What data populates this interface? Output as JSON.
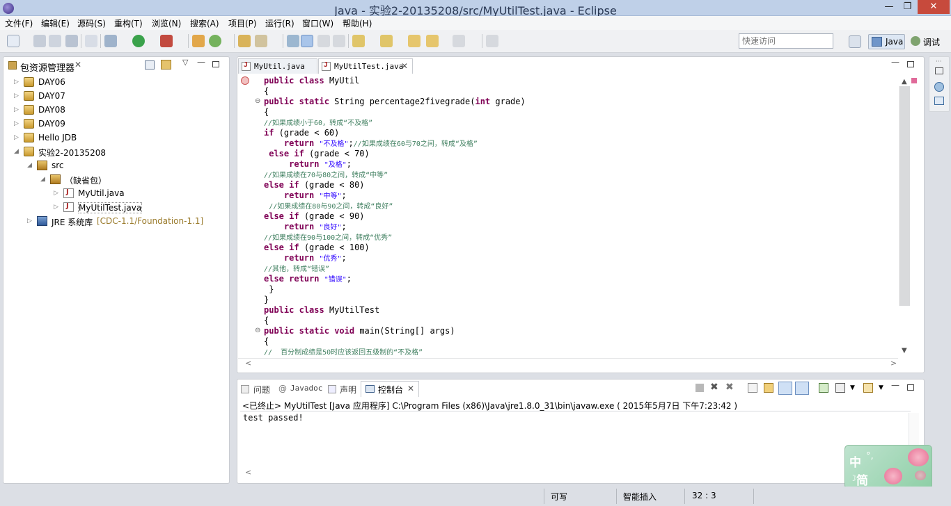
{
  "window": {
    "title": "Java  -  实验2-20135208/src/MyUtilTest.java  -  Eclipse",
    "min": "—",
    "max": "❐",
    "close": "✕"
  },
  "menu": [
    "文件(F)",
    "编辑(E)",
    "源码(S)",
    "重构(T)",
    "浏览(N)",
    "搜索(A)",
    "项目(P)",
    "运行(R)",
    "窗口(W)",
    "帮助(H)"
  ],
  "toolbar": {
    "quick_access_placeholder": "快速访问"
  },
  "perspectives": {
    "java": "Java",
    "debug": "调试"
  },
  "package_explorer": {
    "title": "包资源管理器",
    "items": [
      {
        "label": "DAY06"
      },
      {
        "label": "DAY07"
      },
      {
        "label": "DAY08"
      },
      {
        "label": "DAY09"
      },
      {
        "label": "Hello JDB"
      },
      {
        "label": "实验2-20135208"
      },
      {
        "label": "src"
      },
      {
        "label": "（缺省包）"
      },
      {
        "label": "MyUtil.java"
      },
      {
        "label": "MyUtilTest.java"
      },
      {
        "label": "JRE 系统库",
        "suffix": "[CDC-1.1/Foundation-1.1]"
      }
    ]
  },
  "editor": {
    "tabs": [
      {
        "label": "MyUtil.java"
      },
      {
        "label": "MyUtilTest.java"
      }
    ],
    "lines": [
      {
        "t": "public class MyUtil"
      },
      {
        "t": "{"
      },
      {
        "t": "public static String percentage2fivegrade(int grade)"
      },
      {
        "t": "{"
      },
      {
        "t": "//如果成绩小于60，转成“不及格”"
      },
      {
        "t": "if (grade < 60)"
      },
      {
        "t": "    return \"不及格\";//如果成绩在60与70之间，转成“及格”"
      },
      {
        "t": " else if (grade < 70)"
      },
      {
        "t": "     return \"及格\";"
      },
      {
        "t": "//如果成绩在70与80之间，转成“中等”"
      },
      {
        "t": "else if (grade < 80)"
      },
      {
        "t": "    return \"中等\";"
      },
      {
        "t": " //如果成绩在80与90之间，转成“良好”"
      },
      {
        "t": "else if (grade < 90)"
      },
      {
        "t": "    return \"良好\";"
      },
      {
        "t": "//如果成绩在90与100之间，转成“优秀”"
      },
      {
        "t": "else if (grade < 100)"
      },
      {
        "t": "    return \"优秀\";"
      },
      {
        "t": "//其他，转成“错误”"
      },
      {
        "t": "else return \"错误\";"
      },
      {
        "t": " }"
      },
      {
        "t": "}"
      },
      {
        "t": "public class MyUtilTest"
      },
      {
        "t": "{"
      },
      {
        "t": "public static void main(String[] args)"
      },
      {
        "t": "{"
      },
      {
        "t": "//  百分制成绩是50时应该返回五级制的“不及格”"
      }
    ]
  },
  "console": {
    "tabs": [
      "问题",
      "Javadoc",
      "声明",
      "控制台"
    ],
    "header": "<已终止> MyUtilTest [Java 应用程序] C:\\Program Files (x86)\\Java\\jre1.8.0_31\\bin\\javaw.exe ( 2015年5月7日 下午7:23:42 )",
    "output": "test passed!"
  },
  "status": {
    "writable": "可写",
    "insert_mode": "智能插入",
    "position": "32 : 3"
  },
  "ime": {
    "lang": "中",
    "mode": "简",
    "punct": "°,"
  }
}
